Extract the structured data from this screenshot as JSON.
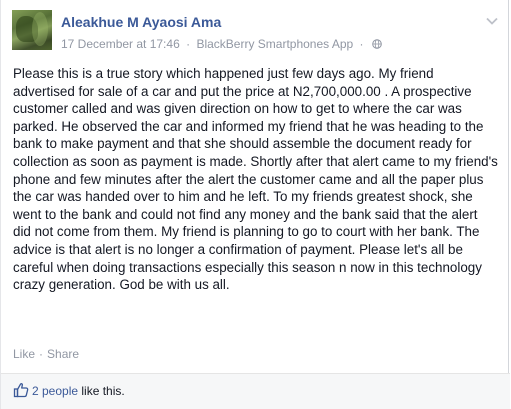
{
  "post": {
    "author": "Aleakhue M Ayaosi Ama",
    "date": "17 December at 17:46",
    "separator": "·",
    "source": "BlackBerry Smartphones App",
    "separator2": "·",
    "privacy_icon": "globe-icon",
    "menu_icon": "chevron-down-icon",
    "body": "Please this is a true story which happened just few days ago. My friend advertised for sale of a car and put the price at N2,700,000.00 . A prospective customer called and was given direction on how to get to where the car was parked. He observed the car and informed my friend that he was heading to the bank to make payment and that she should assemble the document ready for collection as soon as payment is made. Shortly after that alert came to my friend's phone and few minutes after the alert the customer came and all the paper plus the car was handed over to him and he left. To my friends greatest shock, she went to the bank and could not find any money and the bank said that the alert did not come from them. My friend is planning to go to court with her bank. The advice is that alert is no longer a confirmation of payment. Please let's all be careful when doing transactions especially this season n now in this technology crazy generation. God be with us all."
  },
  "actions": {
    "like": "Like",
    "dot": "·",
    "share": "Share"
  },
  "likes": {
    "icon": "thumbs-up-icon",
    "count_text": "2 people",
    "suffix": " like this."
  },
  "colors": {
    "link": "#3b5998",
    "meta": "#9197a3",
    "text": "#141823",
    "likes_bar": "#f6f7f8"
  }
}
